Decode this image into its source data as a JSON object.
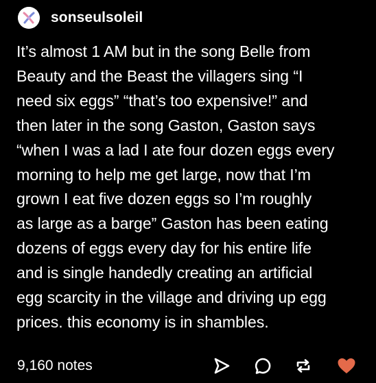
{
  "post": {
    "username": "sonseulsoleil",
    "body_lines": [
      "It’s almost 1 AM but in the song Belle from",
      "Beauty and the Beast the villagers sing “I",
      "need six eggs” “that’s too expensive!” and",
      "then later in the song Gaston, Gaston says",
      "“when I was a lad I ate four dozen eggs every",
      "morning to help me get large, now that I’m",
      "grown I eat five dozen eggs so I’m roughly",
      "as large as a barge” Gaston has been eating",
      "dozens of eggs every day for his entire life",
      "and is single handedly creating an artificial",
      "egg scarcity in the village and driving up egg",
      "prices. this economy is in shambles."
    ]
  },
  "footer": {
    "notes_label": "9,160 notes",
    "actions": {
      "share_icon": "share-icon",
      "reply_icon": "reply-icon",
      "reblog_icon": "reblog-icon",
      "like_icon": "heart-icon"
    }
  },
  "colors": {
    "background": "#000000",
    "text": "#ffffff",
    "like": "#e46a4a",
    "avatar_pink": "#e88aa8",
    "avatar_blue": "#7a8ad8"
  }
}
